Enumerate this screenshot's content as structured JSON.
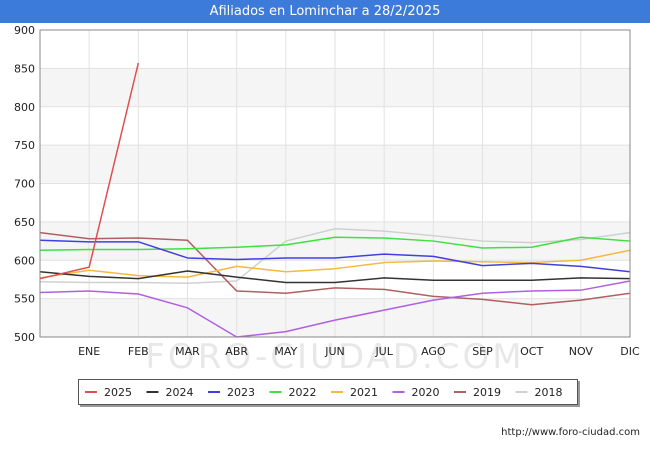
{
  "title": "Afiliados en Lominchar a 28/2/2025",
  "source": "http://www.foro-ciudad.com",
  "watermark": "FORO-CIUDAD.COM",
  "chart_data": {
    "type": "line",
    "title": "Afiliados en Lominchar a 28/2/2025",
    "categories": [
      "",
      "ENE",
      "FEB",
      "MAR",
      "ABR",
      "MAY",
      "JUN",
      "JUL",
      "AGO",
      "SEP",
      "OCT",
      "NOV",
      "DIC"
    ],
    "ylim": [
      500,
      900
    ],
    "yticks": [
      500,
      550,
      600,
      650,
      700,
      750,
      800,
      850,
      900
    ],
    "grid": true,
    "legend_position": "bottom",
    "series": [
      {
        "name": "2025",
        "color": "#e05050",
        "values": [
          576,
          591,
          857
        ]
      },
      {
        "name": "2024",
        "color": "#333333",
        "values": [
          585,
          579,
          576,
          586,
          578,
          571,
          571,
          577,
          574,
          574,
          574,
          577,
          576
        ]
      },
      {
        "name": "2023",
        "color": "#4040e0",
        "values": [
          626,
          624,
          624,
          603,
          601,
          603,
          603,
          608,
          605,
          593,
          596,
          592,
          585
        ]
      },
      {
        "name": "2022",
        "color": "#40e040",
        "values": [
          613,
          614,
          614,
          615,
          617,
          620,
          630,
          629,
          625,
          616,
          617,
          630,
          625
        ]
      },
      {
        "name": "2021",
        "color": "#f5b840",
        "values": [
          577,
          587,
          580,
          578,
          592,
          585,
          589,
          597,
          599,
          598,
          597,
          600,
          613
        ]
      },
      {
        "name": "2020",
        "color": "#b060e0",
        "values": [
          558,
          560,
          556,
          538,
          500,
          507,
          522,
          535,
          548,
          557,
          560,
          561,
          573
        ]
      },
      {
        "name": "2019",
        "color": "#b06060",
        "values": [
          636,
          628,
          629,
          626,
          560,
          557,
          564,
          562,
          553,
          549,
          542,
          548,
          557
        ]
      },
      {
        "name": "2018",
        "color": "#d0d0d0",
        "values": [
          572,
          571,
          571,
          570,
          573,
          625,
          641,
          638,
          632,
          625,
          623,
          627,
          636
        ]
      }
    ]
  }
}
